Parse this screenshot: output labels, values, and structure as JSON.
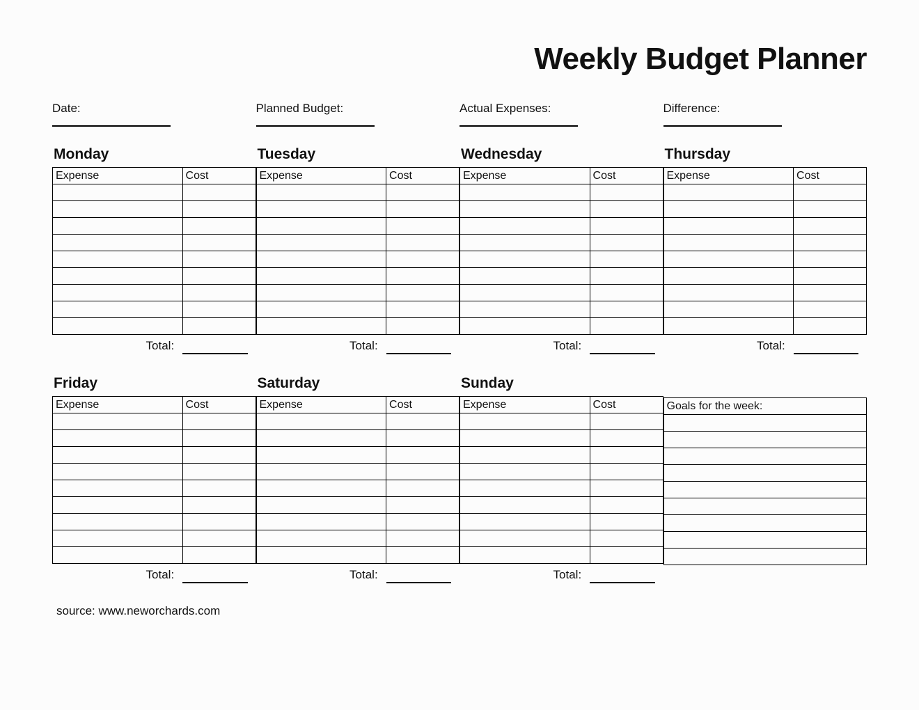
{
  "title": "Weekly Budget Planner",
  "info": {
    "date_label": "Date:",
    "planned_label": "Planned Budget:",
    "actual_label": "Actual Expenses:",
    "difference_label": "Difference:"
  },
  "headers": {
    "expense": "Expense",
    "cost": "Cost",
    "total": "Total:",
    "goals": "Goals for the week:"
  },
  "days_top": [
    "Monday",
    "Tuesday",
    "Wednesday",
    "Thursday"
  ],
  "days_bottom": [
    "Friday",
    "Saturday",
    "Sunday"
  ],
  "rows_per_day": 9,
  "source": "source: www.neworchards.com"
}
